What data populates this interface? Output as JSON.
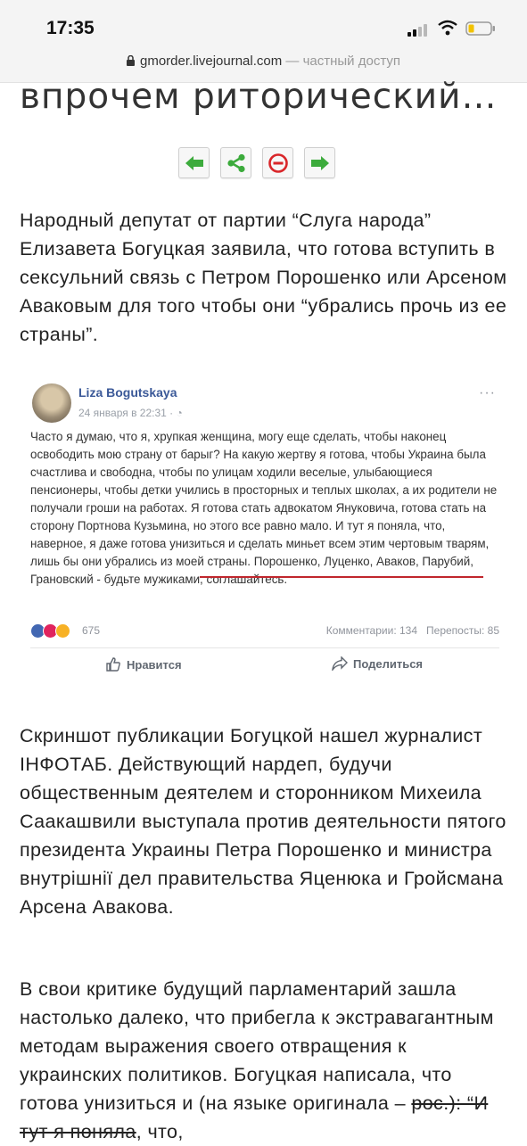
{
  "status_bar": {
    "time": "17:35"
  },
  "url_bar": {
    "domain": "gmorder.livejournal.com",
    "access": "— частный доступ"
  },
  "article": {
    "headline": "впрочем риторический…",
    "nav": {
      "back_icon": "arrow-left-icon",
      "share_icon": "share-icon",
      "block_icon": "minus-circle-icon",
      "forward_icon": "arrow-right-icon"
    },
    "paragraph1": "Народный депутат от партии “Слуга народа” Елизавета Богуцкая заявила, что готова вступить в сексульний связь с Петром Порошенко или Арсеном Аваковым для того чтобы они “убрались прочь из ее страны”.",
    "paragraph2": "Скриншот публикации Богуцкой нашел журналист ІНФОТАБ. Действующий нардеп, будучи общественным деятелем и сторонником Михеила Саакашвили выступала против деятельности пятого президента Украины Петра Порошенко и министра внутрішнії дел правительства Яценюка и Гройсмана Арсена Авакова.",
    "paragraph3_start": "В свои критике будущий парламентарий зашла настолько далеко, что прибегла к экстравагантным методам выражения своего отвращения к украинских политиков. Богуцкая написала, что готова унизиться и (на языке оригинала – ",
    "paragraph3_struck": "рос.): “И тут я поняла",
    "paragraph3_end": ", что,"
  },
  "post": {
    "author": "Liza Bogutskaya",
    "date": "24 января в 22:31 · ",
    "more": "···",
    "text": "Часто я думаю, что я, хрупкая женщина, могу еще сделать, чтобы наконец освободить мою страну от барыг? На какую жертву я готова, чтобы Украина была счастлива и свободна, чтобы по улицам ходили веселые, улыбающиеся пенсионеры, чтобы детки учились в просторных и теплых школах, а их родители не получали гроши на работах. Я готова стать адвокатом Януковича, готова стать на сторону Портнова Кузьмина, но этого все равно мало. И тут я поняла, что, наверное, я даже готова унизиться и сделать миньет всем этим чертовым тварям, лишь бы они убрались из моей страны. Порошенко, Луценко, Аваков, Парубий, Грановский - будьте мужиками, соглашайтесь.",
    "reactions_count": "675",
    "comments": "Комментарии: 134",
    "shares": "Перепосты: 85",
    "like_label": "Нравится",
    "share_label": "Поделиться"
  },
  "colors": {
    "nav_green": "#3cab3c",
    "nav_red": "#d9262a",
    "fb_blue": "#3b5998",
    "underline_red": "#c0262d"
  }
}
